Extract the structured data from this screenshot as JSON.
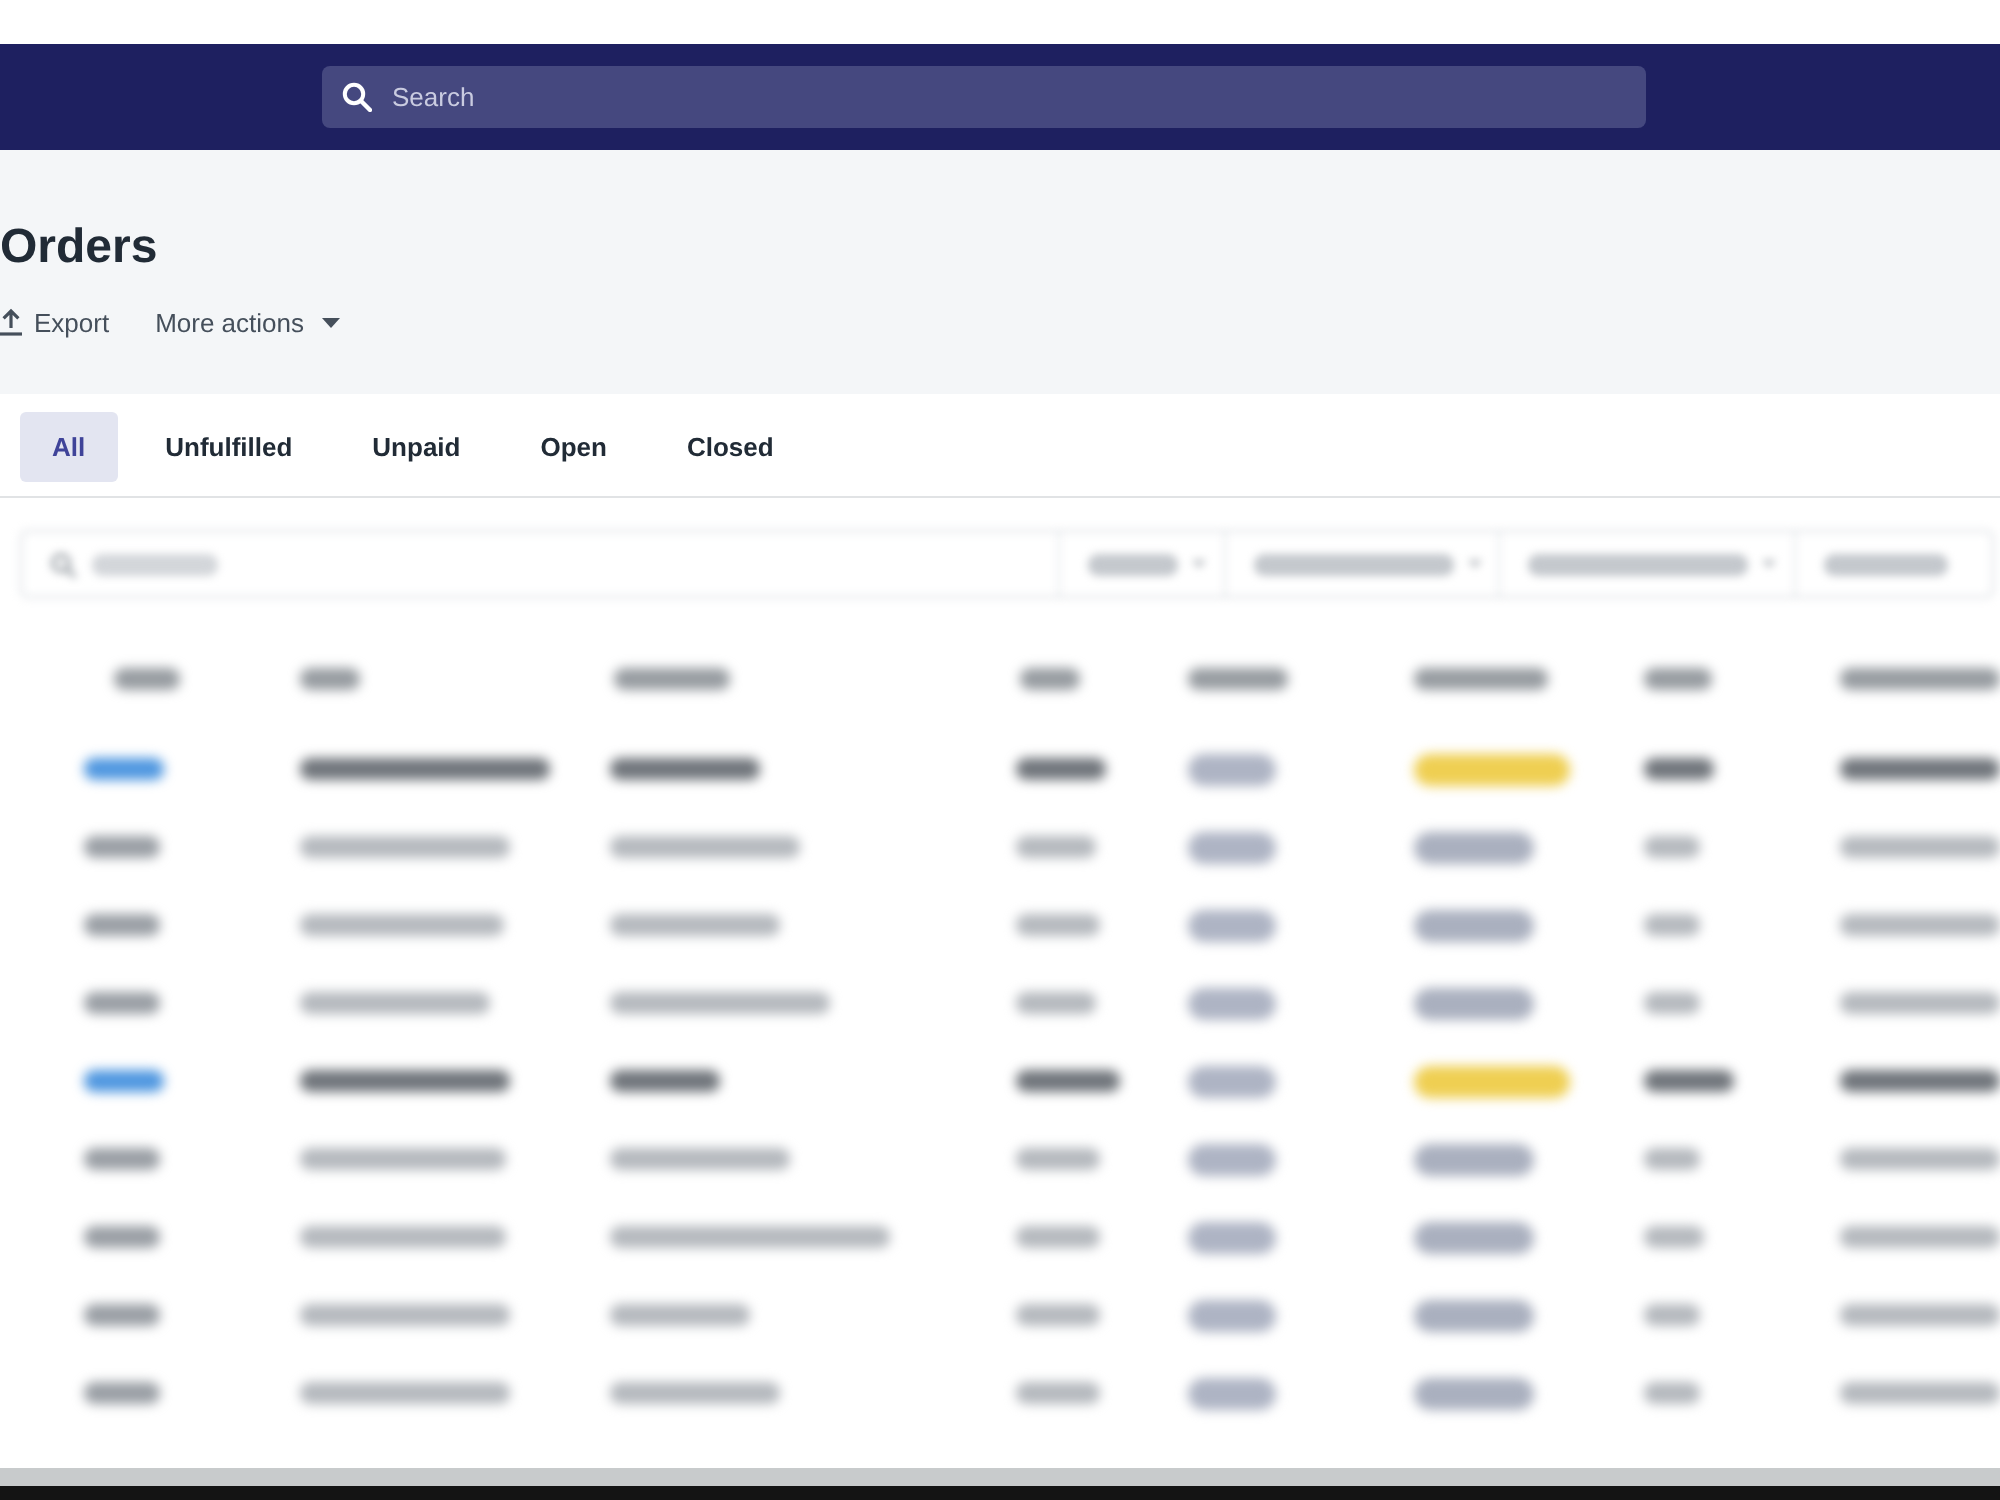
{
  "top_bar": {
    "search": {
      "placeholder": "Search"
    }
  },
  "page_header": {
    "title": "Orders",
    "actions": [
      {
        "kind": "export",
        "label": "Export"
      },
      {
        "kind": "menu",
        "label": "More actions"
      }
    ]
  },
  "tabs": [
    {
      "label": "All",
      "selected": true
    },
    {
      "label": "Unfulfilled",
      "selected": false
    },
    {
      "label": "Unpaid",
      "selected": false
    },
    {
      "label": "Open",
      "selected": false
    },
    {
      "label": "Closed",
      "selected": false
    }
  ],
  "orders_table": {
    "rows": [
      {
        "order_number": {
          "color": "#4f97e0"
        },
        "text": {
          "color": "#70757b"
        },
        "fulfillment_badge": {
          "color": "#efcf52"
        }
      },
      {
        "order_number": {
          "color": "#9a9fa5"
        },
        "text": {
          "color": "#b5b9be"
        },
        "fulfillment_badge": {
          "color": "#aab0bf"
        }
      },
      {
        "order_number": {
          "color": "#9a9fa5"
        },
        "text": {
          "color": "#b5b9be"
        },
        "fulfillment_badge": {
          "color": "#aab0bf"
        }
      },
      {
        "order_number": {
          "color": "#9a9fa5"
        },
        "text": {
          "color": "#b5b9be"
        },
        "fulfillment_badge": {
          "color": "#aab0bf"
        }
      },
      {
        "order_number": {
          "color": "#4f97e0"
        },
        "text": {
          "color": "#70757b"
        },
        "fulfillment_badge": {
          "color": "#efcf52"
        }
      },
      {
        "order_number": {
          "color": "#9a9fa5"
        },
        "text": {
          "color": "#b5b9be"
        },
        "fulfillment_badge": {
          "color": "#aab0bf"
        }
      },
      {
        "order_number": {
          "color": "#9a9fa5"
        },
        "text": {
          "color": "#b5b9be"
        },
        "fulfillment_badge": {
          "color": "#aab0bf"
        }
      },
      {
        "order_number": {
          "color": "#9a9fa5"
        },
        "text": {
          "color": "#b5b9be"
        },
        "fulfillment_badge": {
          "color": "#aab0bf"
        }
      },
      {
        "order_number": {
          "color": "#9a9fa5"
        },
        "text": {
          "color": "#b5b9be"
        },
        "fulfillment_badge": {
          "color": "#aab0bf"
        }
      }
    ]
  }
}
